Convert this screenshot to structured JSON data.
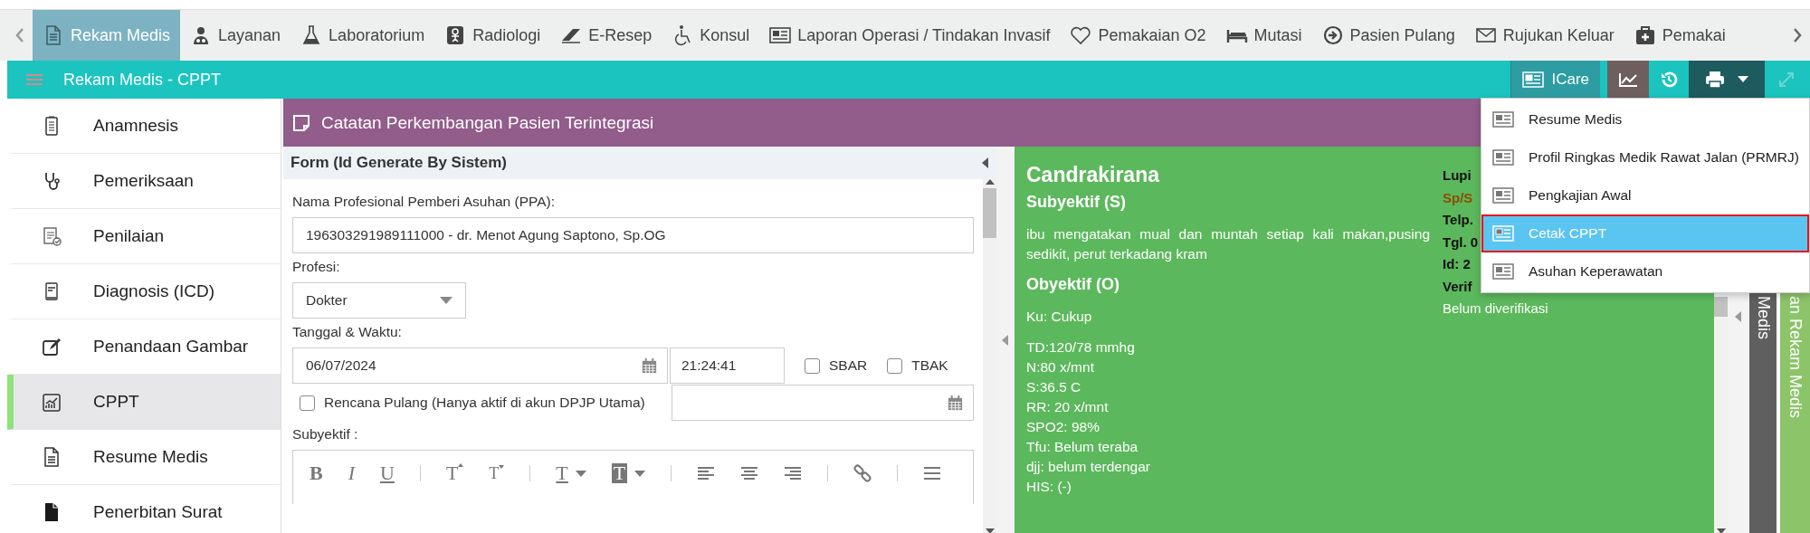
{
  "nav": {
    "tabs": [
      {
        "label": "Rekam Medis",
        "selected": true
      },
      {
        "label": "Layanan",
        "selected": false
      },
      {
        "label": "Laboratorium",
        "selected": false
      },
      {
        "label": "Radiologi",
        "selected": false
      },
      {
        "label": "E-Resep",
        "selected": false
      },
      {
        "label": "Konsul",
        "selected": false
      },
      {
        "label": "Laporan Operasi / Tindakan Invasif",
        "selected": false
      },
      {
        "label": "Pemakaian O2",
        "selected": false
      },
      {
        "label": "Mutasi",
        "selected": false
      },
      {
        "label": "Pasien Pulang",
        "selected": false
      },
      {
        "label": "Rujukan Keluar",
        "selected": false
      },
      {
        "label": "Pemakai",
        "selected": false
      }
    ]
  },
  "module_bar": {
    "title": "Rekam Medis - CPPT",
    "icare_button": "ICare"
  },
  "sidebar": {
    "items": [
      {
        "label": "Anamnesis",
        "selected": false
      },
      {
        "label": "Pemeriksaan",
        "selected": false
      },
      {
        "label": "Penilaian",
        "selected": false
      },
      {
        "label": "Diagnosis (ICD)",
        "selected": false
      },
      {
        "label": "Penandaan Gambar",
        "selected": false
      },
      {
        "label": "CPPT",
        "selected": true
      },
      {
        "label": "Resume Medis",
        "selected": false
      },
      {
        "label": "Penerbitan Surat",
        "selected": false
      }
    ]
  },
  "panel": {
    "title": "Catatan Perkembangan Pasien Terintegrasi"
  },
  "form": {
    "title": "Form (Id Generate By Sistem)",
    "ppa_label": "Nama Profesional Pemberi Asuhan (PPA):",
    "ppa_value": "196303291989111000 - dr. Menot Agung Saptono, Sp.OG",
    "profesi_label": "Profesi:",
    "profesi_value": "Dokter",
    "datetime_label": "Tanggal & Waktu:",
    "date_value": "06/07/2024",
    "time_value": "21:24:41",
    "flags": [
      {
        "label": "SBAR",
        "checked": false
      },
      {
        "label": "TBAK",
        "checked": false
      }
    ],
    "rencana_pulang": {
      "label": "Rencana Pulang (Hanya aktif di akun DPJP Utama)",
      "checked": false
    },
    "subyektif_label": "Subyektif :",
    "toolbar": [
      {
        "kind": "bold",
        "text": "B"
      },
      {
        "kind": "italic",
        "text": "I"
      },
      {
        "kind": "underline",
        "text": "U"
      },
      {
        "kind": "separator"
      },
      {
        "kind": "superscript",
        "text": "T"
      },
      {
        "kind": "subscript",
        "text": "T"
      },
      {
        "kind": "separator"
      },
      {
        "kind": "text-color",
        "text": "T"
      },
      {
        "kind": "highlight",
        "text": "T"
      },
      {
        "kind": "separator"
      },
      {
        "kind": "align-left"
      },
      {
        "kind": "align-center"
      },
      {
        "kind": "align-right"
      },
      {
        "kind": "separator"
      },
      {
        "kind": "link"
      },
      {
        "kind": "separator"
      },
      {
        "kind": "justify"
      }
    ]
  },
  "note": {
    "name": "Candrakirana",
    "sections": [
      {
        "heading": "Subyektif (S)",
        "paragraphs": [
          [
            "ibu mengatakan mual dan muntah setiap kali makan,pusing sedikit, perut terkadang kram"
          ]
        ]
      },
      {
        "heading": "Obyektif (O)",
        "paragraphs": [
          [
            "Ku: Cukup"
          ],
          [
            "TD:120/78 mmhg",
            "N:80 x/mnt",
            "S:36.5 C",
            "RR: 20 x/mnt",
            "SPO2: 98%",
            "Tfu: Belum teraba",
            "djj: belum terdengar",
            "HIS: (-)"
          ]
        ]
      }
    ],
    "side_info": [
      {
        "kind": "bold",
        "text": "Lupi"
      },
      {
        "kind": "specialty",
        "text": "Sp/S"
      },
      {
        "kind": "bold",
        "text": "Telp."
      },
      {
        "kind": "bold",
        "text": "Tgl. 0"
      },
      {
        "kind": "bold",
        "text": "Id: 2"
      },
      {
        "kind": "bold",
        "text": "Verif"
      },
      {
        "kind": "plain",
        "text": "Belum diverifikasi"
      }
    ]
  },
  "vertical_tabs": [
    {
      "label": "Medis",
      "kind": "dark"
    },
    {
      "label": "an Rekam Medis",
      "kind": "light"
    }
  ],
  "print_menu": {
    "items": [
      {
        "label": "Resume Medis",
        "selected": false
      },
      {
        "label": "Profil Ringkas Medik Rawat Jalan (PRMRJ)",
        "selected": false
      },
      {
        "label": "Pengkajian Awal",
        "selected": false
      },
      {
        "label": "Cetak CPPT",
        "selected": true
      },
      {
        "label": "Asuhan Keperawatan",
        "selected": false
      }
    ]
  }
}
